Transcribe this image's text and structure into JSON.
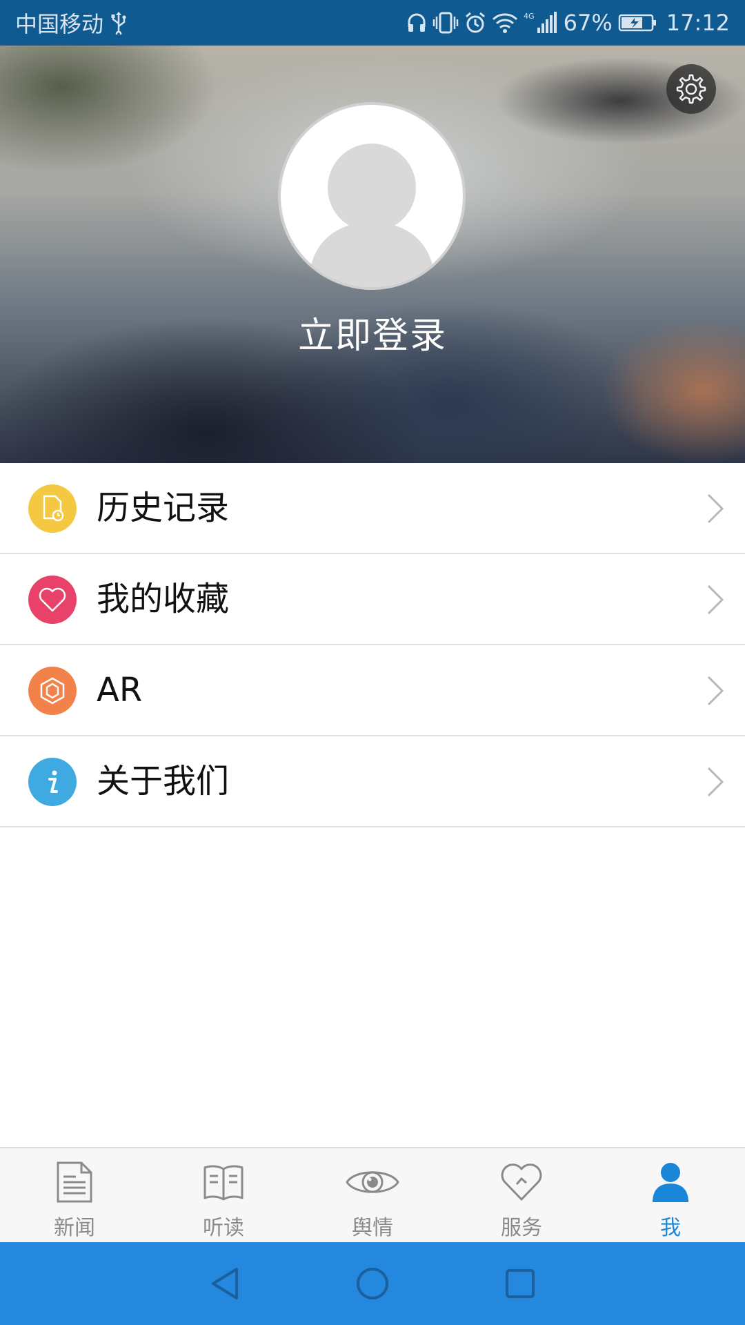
{
  "status_bar": {
    "carrier": "中国移动",
    "network": "4G",
    "battery": "67%",
    "time": "17:12",
    "icons": [
      "usb-icon",
      "headset-icon",
      "vibrate-icon",
      "alarm-icon",
      "wifi-icon",
      "signal-icon",
      "battery-charging-icon"
    ]
  },
  "header": {
    "login_label": "立即登录",
    "settings_icon": "gear-icon",
    "avatar_icon": "default-avatar-icon"
  },
  "menu": {
    "items": [
      {
        "label": "历史记录",
        "icon": "history-document-icon",
        "color": "#f5c842"
      },
      {
        "label": "我的收藏",
        "icon": "heart-icon",
        "color": "#e8416a"
      },
      {
        "label": "AR",
        "icon": "ar-hexagon-icon",
        "color": "#f2824a"
      },
      {
        "label": "关于我们",
        "icon": "info-icon",
        "color": "#3fa9e2"
      }
    ]
  },
  "tabbar": {
    "tabs": [
      {
        "label": "新闻",
        "icon": "news-document-icon",
        "active": false
      },
      {
        "label": "听读",
        "icon": "open-book-icon",
        "active": false
      },
      {
        "label": "舆情",
        "icon": "eye-icon",
        "active": false
      },
      {
        "label": "服务",
        "icon": "heart-outline-icon",
        "active": false
      },
      {
        "label": "我",
        "icon": "person-icon",
        "active": true
      }
    ],
    "active_color": "#1a86d8",
    "inactive_color": "#8a8a8a"
  },
  "navbar": {
    "buttons": [
      "back-icon",
      "home-icon",
      "recents-icon"
    ]
  }
}
